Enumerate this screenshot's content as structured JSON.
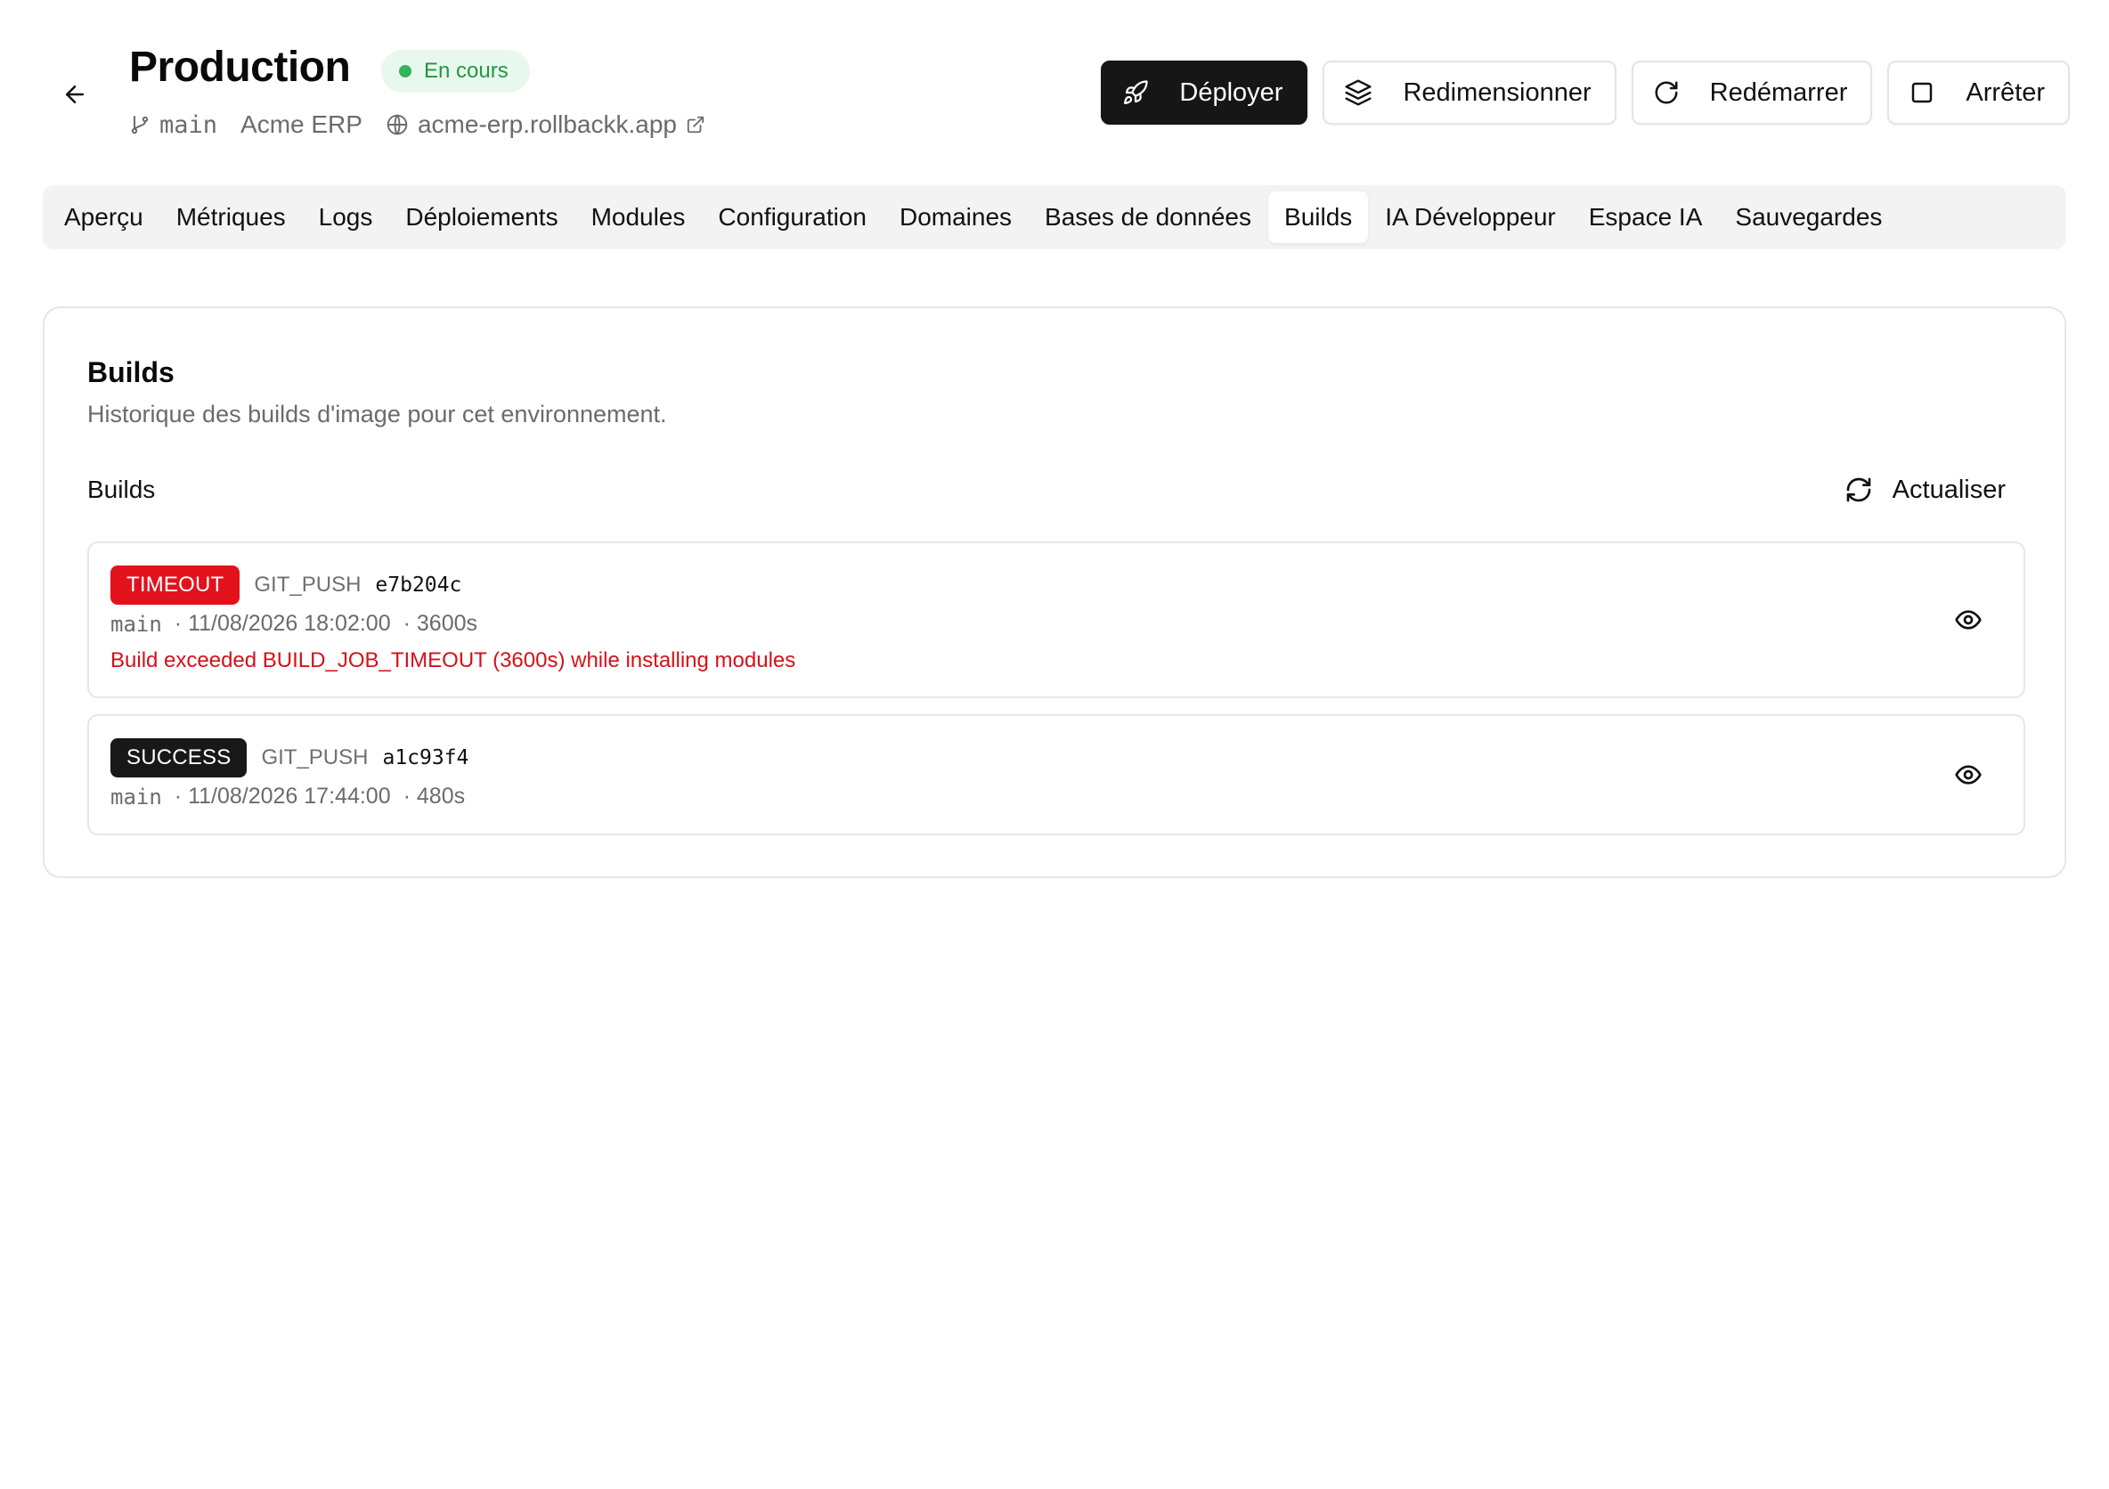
{
  "header": {
    "title": "Production",
    "status": "En cours",
    "branch": "main",
    "project": "Acme ERP",
    "domain": "acme-erp.rollbackk.app"
  },
  "actions": {
    "deploy": "Déployer",
    "resize": "Redimensionner",
    "restart": "Redémarrer",
    "stop": "Arrêter"
  },
  "tabs": [
    {
      "label": "Aperçu"
    },
    {
      "label": "Métriques"
    },
    {
      "label": "Logs"
    },
    {
      "label": "Déploiements"
    },
    {
      "label": "Modules"
    },
    {
      "label": "Configuration"
    },
    {
      "label": "Domaines"
    },
    {
      "label": "Bases de données"
    },
    {
      "label": "Builds"
    },
    {
      "label": "IA Développeur"
    },
    {
      "label": "Espace IA"
    },
    {
      "label": "Sauvegardes"
    }
  ],
  "active_tab": "Builds",
  "card": {
    "title": "Builds",
    "description": "Historique des builds d'image pour cet environnement.",
    "section_label": "Builds",
    "refresh_label": "Actualiser"
  },
  "builds": [
    {
      "status": "TIMEOUT",
      "trigger": "GIT_PUSH",
      "sha": "e7b204c",
      "branch": "main",
      "date": "· 11/08/2026 18:02:00",
      "duration": "· 3600s",
      "error": "Build exceeded BUILD_JOB_TIMEOUT (3600s) while installing modules"
    },
    {
      "status": "SUCCESS",
      "trigger": "GIT_PUSH",
      "sha": "a1c93f4",
      "branch": "main",
      "date": "· 11/08/2026 17:44:00",
      "duration": "· 480s"
    }
  ],
  "colors": {
    "status_green": "#22973f",
    "timeout_red": "#e2121c",
    "error_text": "#d4111a",
    "primary_button": "#161616"
  }
}
